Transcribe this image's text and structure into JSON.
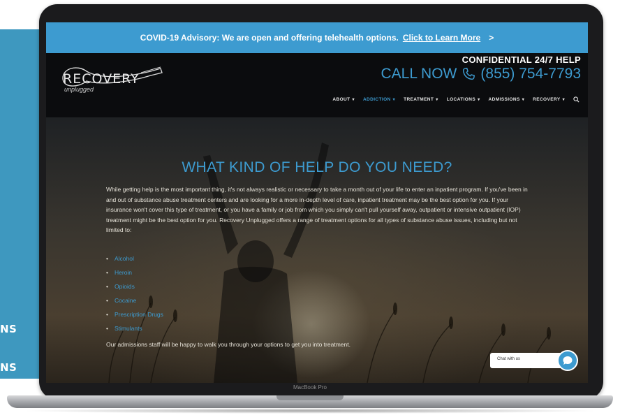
{
  "side_panel": {
    "labels": [
      "NS",
      "NS"
    ],
    "color": "#3e98bf"
  },
  "banner": {
    "text": "COVID-19 Advisory: We are open and offering telehealth options.",
    "link": "Click to Learn More",
    "arrow": ">",
    "color": "#3d9bd0"
  },
  "header": {
    "logo_text": "RECOVERY",
    "logo_sub": "unplugged",
    "help_label": "CONFIDENTIAL 24/7 HELP",
    "call_label": "CALL NOW",
    "phone_icon": "phone-icon",
    "phone": "(855) 754-7793"
  },
  "nav": {
    "items": [
      {
        "label": "ABOUT",
        "active": false
      },
      {
        "label": "ADDICTION",
        "active": true
      },
      {
        "label": "TREATMENT",
        "active": false
      },
      {
        "label": "LOCATIONS",
        "active": false
      },
      {
        "label": "ADMISSIONS",
        "active": false
      },
      {
        "label": "RECOVERY",
        "active": false
      }
    ],
    "caret": "▾",
    "search_icon": "search-icon"
  },
  "hero": {
    "title": "WHAT KIND OF HELP DO YOU NEED?",
    "intro": "While getting help is the most important thing, it's not always realistic or necessary to take a month out of your life to enter an inpatient program. If you've been in and out of substance abuse treatment centers and are looking for a more in-depth level of care, inpatient treatment may be the best option for you. If your insurance won't cover this type of treatment, or you have a family or job from which you simply can't pull yourself away, outpatient or intensive outpatient (IOP) treatment might be the best option for you. Recovery Unplugged offers a range of treatment options for all types of substance abuse issues, including but not limited to:",
    "options": [
      "Alcohol",
      "Heroin",
      "Opioids",
      "Cocaine",
      "Prescription Drugs",
      "Stimulants"
    ],
    "closing": "Our admissions staff will be happy to walk you through your options to get you into treatment."
  },
  "chat": {
    "label": "Chat with us",
    "icon": "chat-bubble-icon"
  },
  "device": {
    "label": "MacBook Pro"
  },
  "colors": {
    "accent": "#3d9bd0",
    "background": "#0b0c0e"
  }
}
